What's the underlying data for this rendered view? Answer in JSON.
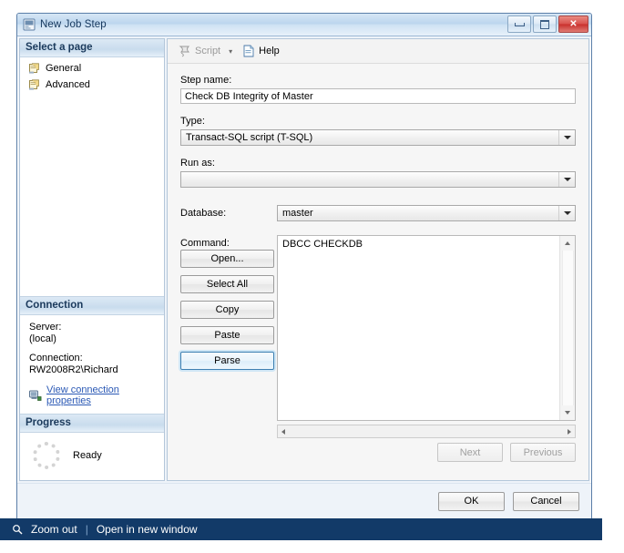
{
  "window": {
    "title": "New Job Step",
    "icon": "job-step-icon",
    "controls": {
      "minimize": "minimize-button",
      "maximize": "maximize-button",
      "close": "close-button",
      "close_glyph": "✕"
    }
  },
  "left_pane": {
    "header": "Select a page",
    "items": [
      {
        "label": "General",
        "icon": "page-icon"
      },
      {
        "label": "Advanced",
        "icon": "page-icon"
      }
    ],
    "connection": {
      "header": "Connection",
      "server_label": "Server:",
      "server_value": "(local)",
      "connection_label": "Connection:",
      "connection_value": "RW2008R2\\Richard",
      "link": "View connection properties",
      "link_icon": "connection-icon",
      "link_color": "#2b59b5"
    },
    "progress": {
      "header": "Progress",
      "status": "Ready",
      "spinner_icon": "progress-spinner-icon"
    }
  },
  "toolbar": {
    "script_label": "Script",
    "script_icon": "script-icon",
    "script_caret": "▾",
    "help_label": "Help",
    "help_icon": "help-icon"
  },
  "form": {
    "step_name": {
      "label": "Step name:",
      "value": "Check DB Integrity of Master",
      "placeholder": ""
    },
    "type": {
      "label": "Type:",
      "value": "Transact-SQL script (T-SQL)",
      "options": [
        "Transact-SQL script (T-SQL)"
      ]
    },
    "run_as": {
      "label": "Run as:",
      "value": "",
      "options": []
    },
    "database": {
      "label": "Database:",
      "value": "master",
      "options": [
        "master"
      ]
    },
    "command": {
      "label": "Command:",
      "value": "DBCC CHECKDB",
      "placeholder": ""
    }
  },
  "side_buttons": [
    {
      "label": "Open...",
      "state": "normal"
    },
    {
      "label": "Select All",
      "state": "normal"
    },
    {
      "label": "Copy",
      "state": "normal"
    },
    {
      "label": "Paste",
      "state": "normal"
    },
    {
      "label": "Parse",
      "state": "focused"
    }
  ],
  "nav_buttons": [
    {
      "label": "Next",
      "state": "disabled"
    },
    {
      "label": "Previous",
      "state": "disabled"
    }
  ],
  "footer_buttons": [
    {
      "label": "OK",
      "state": "normal"
    },
    {
      "label": "Cancel",
      "state": "normal"
    }
  ],
  "bottom_bar": {
    "zoom_out": "Zoom out",
    "zoom_icon": "magnifier-icon",
    "separator": "|",
    "open_new_window": "Open in new window",
    "background": "#123a68"
  }
}
